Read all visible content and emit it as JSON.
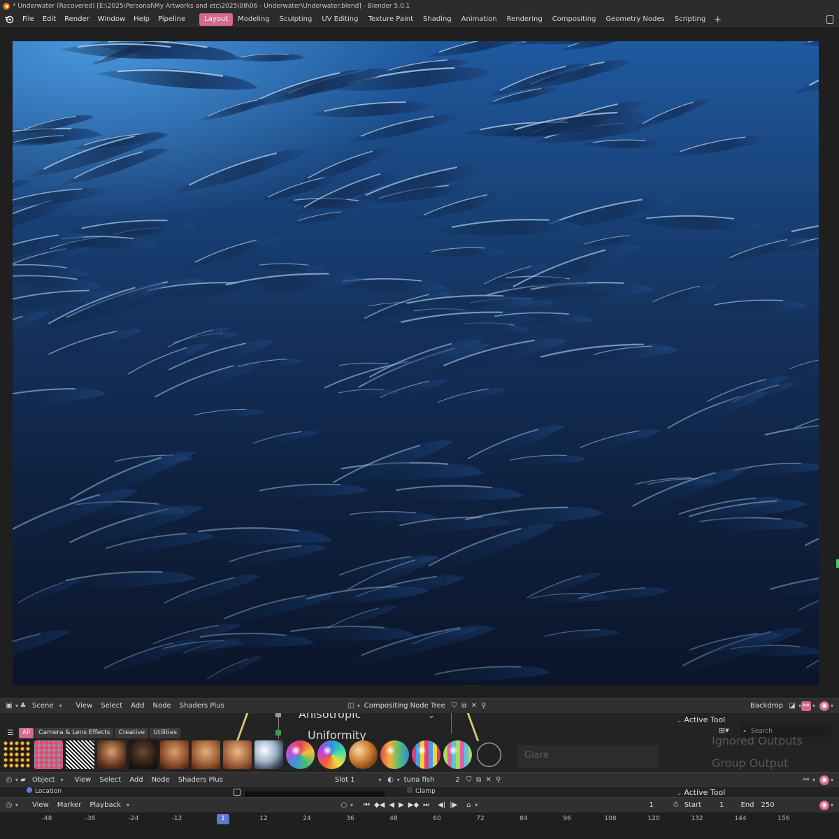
{
  "window": {
    "title": "* Underwater (Recovered) [E:\\2025\\Personal\\My Artworks and etc\\2025\\08\\06 - Underwater\\Underwater.blend] - Blender 5.0.1"
  },
  "menu": [
    "File",
    "Edit",
    "Render",
    "Window",
    "Help",
    "Pipeline"
  ],
  "workspaces": {
    "tabs": [
      "Layout",
      "Modeling",
      "Sculpting",
      "UV Editing",
      "Texture Paint",
      "Shading",
      "Animation",
      "Rendering",
      "Compositing",
      "Geometry Nodes",
      "Scripting"
    ],
    "active": "Layout",
    "add": "+"
  },
  "compositor_header": {
    "scene": "Scene",
    "menus": [
      "View",
      "Select",
      "Add",
      "Node",
      "Shaders Plus"
    ],
    "node_tree": "Compositing Node Tree",
    "backdrop": "Backdrop"
  },
  "node_area": {
    "fragments": [
      "Anisotropic",
      "Uniformity",
      "Glare"
    ],
    "right_panel": {
      "active_tool": "Active Tool",
      "search_placeholder": "Search",
      "ghost_items": [
        "Ignored Outputs",
        "Group Output"
      ]
    }
  },
  "asset_browser": {
    "filters": [
      "All",
      "Camera & Lens Effects",
      "Creative",
      "Utilities"
    ],
    "active_filter": "All"
  },
  "shader_header": {
    "mode": "Object",
    "menus": [
      "View",
      "Select",
      "Add",
      "Node",
      "Shaders Plus"
    ],
    "slot": "Slot 1",
    "material": "tuna fish",
    "users": "2",
    "location_label": "Location",
    "clamp_label": "Clamp",
    "active_tool": "Active Tool"
  },
  "timeline": {
    "menus": [
      "View",
      "Marker",
      "Playback"
    ],
    "current_frame": "1",
    "start_label": "Start",
    "start": "1",
    "end_label": "End",
    "end": "250",
    "ticks": [
      "-48",
      "-36",
      "-24",
      "-12",
      "1",
      "12",
      "24",
      "36",
      "48",
      "60",
      "72",
      "84",
      "96",
      "108",
      "120",
      "132",
      "144",
      "156"
    ]
  },
  "colors": {
    "accent": "#d46a8e",
    "frame_marker": "#5b7bd0",
    "panel": "#303030",
    "background": "#1d1d1d"
  }
}
